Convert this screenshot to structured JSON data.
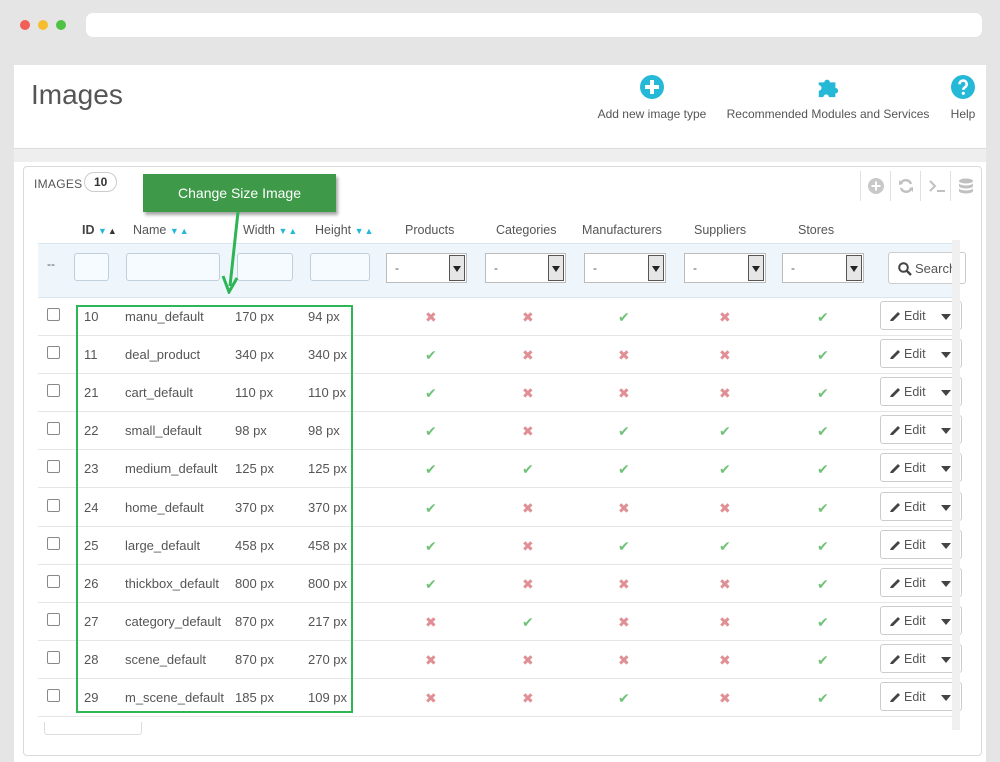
{
  "page": {
    "title": "Images",
    "toolbar": [
      {
        "label": "Add new image type",
        "icon": "plus-circle-icon"
      },
      {
        "label": "Recommended Modules and Services",
        "icon": "puzzle-icon"
      },
      {
        "label": "Help",
        "icon": "question-circle-icon"
      }
    ]
  },
  "panel": {
    "title": "IMAGES",
    "count": "10",
    "tools": [
      "add-icon",
      "refresh-icon",
      "sql-terminal-icon",
      "database-icon"
    ]
  },
  "callout": {
    "label": "Change Size Image"
  },
  "table": {
    "columns": [
      "ID",
      "Name",
      "Width",
      "Height",
      "Products",
      "Categories",
      "Manufacturers",
      "Suppliers",
      "Stores"
    ],
    "filter_placeholder_id": "--",
    "filter_select_value": "-",
    "search_label": "Search",
    "edit_label": "Edit",
    "rows": [
      {
        "id": "10",
        "name": "manu_default",
        "width": "170 px",
        "height": "94 px",
        "products": false,
        "categories": false,
        "manufacturers": true,
        "suppliers": false,
        "stores": true
      },
      {
        "id": "11",
        "name": "deal_product",
        "width": "340 px",
        "height": "340 px",
        "products": true,
        "categories": false,
        "manufacturers": false,
        "suppliers": false,
        "stores": true
      },
      {
        "id": "21",
        "name": "cart_default",
        "width": "110 px",
        "height": "110 px",
        "products": true,
        "categories": false,
        "manufacturers": false,
        "suppliers": false,
        "stores": true
      },
      {
        "id": "22",
        "name": "small_default",
        "width": "98 px",
        "height": "98 px",
        "products": true,
        "categories": false,
        "manufacturers": true,
        "suppliers": true,
        "stores": true
      },
      {
        "id": "23",
        "name": "medium_default",
        "width": "125 px",
        "height": "125 px",
        "products": true,
        "categories": true,
        "manufacturers": true,
        "suppliers": true,
        "stores": true
      },
      {
        "id": "24",
        "name": "home_default",
        "width": "370 px",
        "height": "370 px",
        "products": true,
        "categories": false,
        "manufacturers": false,
        "suppliers": false,
        "stores": true
      },
      {
        "id": "25",
        "name": "large_default",
        "width": "458 px",
        "height": "458 px",
        "products": true,
        "categories": false,
        "manufacturers": true,
        "suppliers": true,
        "stores": true
      },
      {
        "id": "26",
        "name": "thickbox_default",
        "width": "800 px",
        "height": "800 px",
        "products": true,
        "categories": false,
        "manufacturers": false,
        "suppliers": false,
        "stores": true
      },
      {
        "id": "27",
        "name": "category_default",
        "width": "870 px",
        "height": "217 px",
        "products": false,
        "categories": true,
        "manufacturers": false,
        "suppliers": false,
        "stores": true
      },
      {
        "id": "28",
        "name": "scene_default",
        "width": "870 px",
        "height": "270 px",
        "products": false,
        "categories": false,
        "manufacturers": false,
        "suppliers": false,
        "stores": true
      },
      {
        "id": "29",
        "name": "m_scene_default",
        "width": "185 px",
        "height": "109 px",
        "products": false,
        "categories": false,
        "manufacturers": true,
        "suppliers": false,
        "stores": true
      }
    ]
  },
  "colors": {
    "accent": "#25b9d7",
    "check": "#72c279",
    "cross": "#e08f95",
    "highlight": "#2eb556",
    "callout": "#3e9a49"
  }
}
